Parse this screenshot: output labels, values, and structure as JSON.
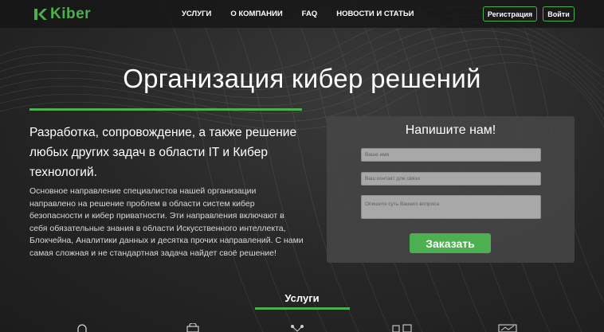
{
  "header": {
    "logo_text": "Kiber",
    "nav": [
      "Услуги",
      "О компании",
      "FAQ",
      "Новости и статьи"
    ],
    "register_label": "Регистрация",
    "login_label": "Войти"
  },
  "hero": {
    "title": "Организация кибер решений",
    "lead": "Разработка, сопровождение, а также решение любых других задач в области IT и Кибер технологий.",
    "description": "Основное направление специалистов нашей организации направлено на решение проблем в области систем кибер безопасности и кибер приватности. Эти направления включают в себя обязательные знания в области Искусственного интеллекта, Блокчейна, Аналитики данных и десятка прочих направлений. С нами самая сложная и не стандартная задача найдет своё решение!"
  },
  "form": {
    "title": "Напишите нам!",
    "name_placeholder": "Ваше имя",
    "contact_placeholder": "Ваш контакт для связи",
    "message_placeholder": "Опишите суть Вашего вопроса",
    "submit_label": "Заказать"
  },
  "services": {
    "title": "Услуги",
    "icons": [
      "support-icon",
      "lock-icon",
      "network-icon",
      "devices-icon",
      "chart-icon"
    ]
  },
  "colors": {
    "accent": "#4caf50",
    "background": "#2a2a2a",
    "card": "#464646"
  }
}
